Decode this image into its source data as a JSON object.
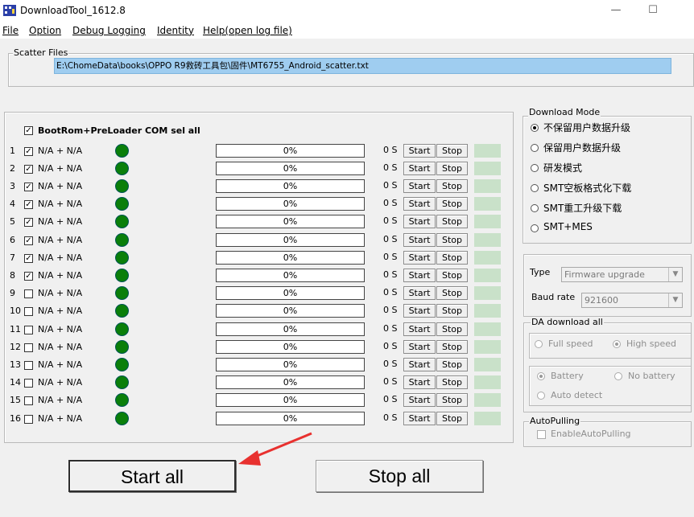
{
  "window": {
    "title": "DownloadTool_1612.8",
    "controls": {
      "minimize": "—",
      "maximize": "☐"
    }
  },
  "menu": [
    "File",
    "Option",
    "Debug Logging",
    "Identity",
    "Help(open log file)"
  ],
  "scatter": {
    "label": "Scatter Files",
    "path": "E:\\ChomeData\\books\\OPPO R9救砖工具包\\固件\\MT6755_Android_scatter.txt"
  },
  "select_all_label": "BootRom+PreLoader COM sel all",
  "rows": [
    {
      "num": "1",
      "checked": true,
      "name": "N/A + N/A",
      "progress": "0%",
      "secs": "0 S",
      "start": "Start",
      "stop": "Stop"
    },
    {
      "num": "2",
      "checked": true,
      "name": "N/A + N/A",
      "progress": "0%",
      "secs": "0 S",
      "start": "Start",
      "stop": "Stop"
    },
    {
      "num": "3",
      "checked": true,
      "name": "N/A + N/A",
      "progress": "0%",
      "secs": "0 S",
      "start": "Start",
      "stop": "Stop"
    },
    {
      "num": "4",
      "checked": true,
      "name": "N/A + N/A",
      "progress": "0%",
      "secs": "0 S",
      "start": "Start",
      "stop": "Stop"
    },
    {
      "num": "5",
      "checked": true,
      "name": "N/A + N/A",
      "progress": "0%",
      "secs": "0 S",
      "start": "Start",
      "stop": "Stop"
    },
    {
      "num": "6",
      "checked": true,
      "name": "N/A + N/A",
      "progress": "0%",
      "secs": "0 S",
      "start": "Start",
      "stop": "Stop"
    },
    {
      "num": "7",
      "checked": true,
      "name": "N/A + N/A",
      "progress": "0%",
      "secs": "0 S",
      "start": "Start",
      "stop": "Stop"
    },
    {
      "num": "8",
      "checked": true,
      "name": "N/A + N/A",
      "progress": "0%",
      "secs": "0 S",
      "start": "Start",
      "stop": "Stop"
    },
    {
      "num": "9",
      "checked": false,
      "name": "N/A + N/A",
      "progress": "0%",
      "secs": "0 S",
      "start": "Start",
      "stop": "Stop"
    },
    {
      "num": "10",
      "checked": false,
      "name": "N/A + N/A",
      "progress": "0%",
      "secs": "0 S",
      "start": "Start",
      "stop": "Stop"
    },
    {
      "num": "11",
      "checked": false,
      "name": "N/A + N/A",
      "progress": "0%",
      "secs": "0 S",
      "start": "Start",
      "stop": "Stop"
    },
    {
      "num": "12",
      "checked": false,
      "name": "N/A + N/A",
      "progress": "0%",
      "secs": "0 S",
      "start": "Start",
      "stop": "Stop"
    },
    {
      "num": "13",
      "checked": false,
      "name": "N/A + N/A",
      "progress": "0%",
      "secs": "0 S",
      "start": "Start",
      "stop": "Stop"
    },
    {
      "num": "14",
      "checked": false,
      "name": "N/A + N/A",
      "progress": "0%",
      "secs": "0 S",
      "start": "Start",
      "stop": "Stop"
    },
    {
      "num": "15",
      "checked": false,
      "name": "N/A + N/A",
      "progress": "0%",
      "secs": "0 S",
      "start": "Start",
      "stop": "Stop"
    },
    {
      "num": "16",
      "checked": false,
      "name": "N/A + N/A",
      "progress": "0%",
      "secs": "0 S",
      "start": "Start",
      "stop": "Stop"
    }
  ],
  "download_mode": {
    "label": "Download Mode",
    "options": [
      {
        "label": "不保留用户数据升级",
        "selected": true
      },
      {
        "label": "保留用户数据升级",
        "selected": false
      },
      {
        "label": "研发模式",
        "selected": false
      },
      {
        "label": "SMT空板格式化下载",
        "selected": false
      },
      {
        "label": "SMT重工升级下载",
        "selected": false
      },
      {
        "label": "SMT+MES",
        "selected": false
      }
    ]
  },
  "type": {
    "label": "Type",
    "value": "Firmware upgrade"
  },
  "baud": {
    "label": "Baud rate",
    "value": "921600"
  },
  "da_download": {
    "label": "DA download all",
    "full_speed": "Full speed",
    "high_speed": "High speed",
    "battery": "Battery",
    "no_battery": "No battery",
    "auto_detect": "Auto detect"
  },
  "autopulling": {
    "label": "AutoPulling",
    "checkbox": "EnableAutoPulling"
  },
  "buttons": {
    "start_all": "Start all",
    "stop_all": "Stop all"
  },
  "colors": {
    "led": "#0a7f0a",
    "status_cell": "#c9e1c9",
    "scatter_highlight": "#9fcdf0",
    "arrow": "#e8312f"
  }
}
